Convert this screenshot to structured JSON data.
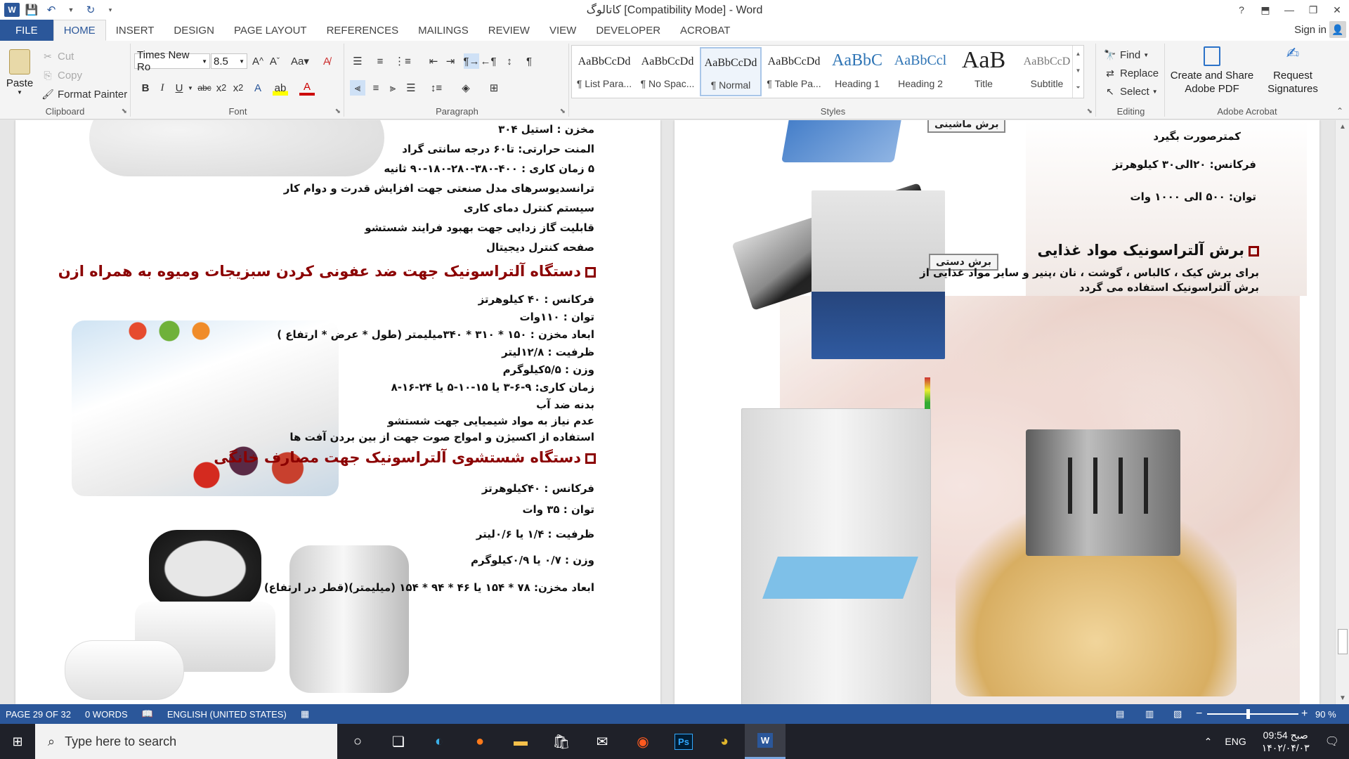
{
  "window": {
    "title": "کاتالوگ [Compatibility Mode] - Word",
    "help": "?",
    "controls": [
      "—",
      "❐",
      "✕"
    ]
  },
  "tabs": [
    "FILE",
    "HOME",
    "INSERT",
    "DESIGN",
    "PAGE LAYOUT",
    "REFERENCES",
    "MAILINGS",
    "REVIEW",
    "VIEW",
    "DEVELOPER",
    "ACROBAT"
  ],
  "active_tab": "HOME",
  "account": {
    "signin": "Sign in"
  },
  "ribbon": {
    "clipboard": {
      "paste": "Paste",
      "cut": "Cut",
      "copy": "Copy",
      "format_painter": "Format Painter",
      "label": "Clipboard"
    },
    "font": {
      "name": "Times New Ro",
      "size": "8.5",
      "label": "Font"
    },
    "paragraph": {
      "label": "Paragraph"
    },
    "styles": {
      "label": "Styles",
      "items": [
        {
          "sample": "AaBbCcDd",
          "name": "¶ List Para..."
        },
        {
          "sample": "AaBbCcDd",
          "name": "¶ No Spac..."
        },
        {
          "sample": "AaBbCcDd",
          "name": "¶ Normal"
        },
        {
          "sample": "AaBbCcDd",
          "name": "¶ Table Pa..."
        },
        {
          "sample": "AaBbC",
          "name": "Heading 1"
        },
        {
          "sample": "AaBbCcl",
          "name": "Heading 2"
        },
        {
          "sample": "AaB",
          "name": "Title"
        },
        {
          "sample": "AaBbCcD",
          "name": "Subtitle"
        }
      ],
      "selected_index": 2
    },
    "editing": {
      "find": "Find",
      "replace": "Replace",
      "select": "Select",
      "label": "Editing"
    },
    "acrobat": {
      "create_share": "Create and Share Adobe PDF",
      "request": "Request Signatures",
      "label": "Adobe Acrobat"
    }
  },
  "left_page": {
    "specs_top": [
      "مخزن : استیل ۳۰۴",
      "المنت حرارتی: تا۶۰ درجه سانتی گراد",
      "۵ زمان کاری : ۴۰۰-۳۸۰-۲۸۰-۱۸۰-۹۰ ثانیه",
      "ترانسدیوسرهای مدل صنعتی جهت افزایش قدرت و دوام کار",
      "سیستم کنترل دمای کاری",
      "قابلیت گاز زدایی جهت بهبود فرایند شستشو",
      "صفحه کنترل دیجیتال"
    ],
    "heading1": "دستگاه آلتراسونیک جهت ضد عفونی کردن سبزیجات ومیوه به همراه ازن",
    "specs_mid": [
      "فرکانس : ۴۰ کیلوهرتز",
      "توان : ۱۱۰وات",
      "ابعاد مخزن : ۱۵۰ * ۳۱۰ * ۳۴۰میلیمتر (طول * عرض * ارتفاع )",
      "ظرفیت : ۱۲/۸لیتر",
      "وزن : ۵/۵کیلوگرم",
      "زمان کاری: ۹-۶-۳ یا ۱۵-۱۰-۵ یا ۲۴-۱۶-۸",
      "بدنه ضد آب",
      "عدم نیاز به مواد شیمیایی جهت شستشو",
      "استفاده از اکسیژن و امواج صوت جهت از بین بردن آفت ها"
    ],
    "heading2": "دستگاه شستشوی آلتراسونیک جهت مصارف خانگی",
    "specs_bottom": [
      "فرکانس : ۴۰کیلوهرتز",
      "توان : ۳۵ وات",
      "ظرفیت : ۱/۴ یا ۰/۶لیتر",
      "وزن : ۰/۷ یا ۰/۹کیلوگرم",
      "ابعاد مخزن: ۷۸ * ۱۵۴ یا ۴۶ * ۹۴ * ۱۵۴ (میلیمتر)(قطر در ارتفاع)"
    ]
  },
  "right_page": {
    "caption_top": "برش ماشینی",
    "line_top": "کمترصورت بگیرد",
    "freq": "فرکانس: ۲۰الی۳۰ کیلوهرتز",
    "power": "توان: ۵۰۰ الی ۱۰۰۰ وات",
    "caption_manual": "برش دستی",
    "heading": "برش آلتراسونیک مواد غذایی",
    "desc1": "برای برش کیک ، کالباس ، گوشت ، نان ،پنیر و سایر مواد غذایی از",
    "desc2": "برش آلتراسونیک استفاده می گردد"
  },
  "status": {
    "page": "PAGE 29 OF 32",
    "words": "0 WORDS",
    "language": "ENGLISH (UNITED STATES)",
    "zoom": "90 %"
  },
  "taskbar": {
    "search_placeholder": "Type here to search",
    "lang": "ENG",
    "time": "09:54 صبح",
    "date": "۱۴۰۲/۰۴/۰۳"
  },
  "colors": {
    "accent": "#2b579a",
    "heading_red": "#8b0000"
  }
}
